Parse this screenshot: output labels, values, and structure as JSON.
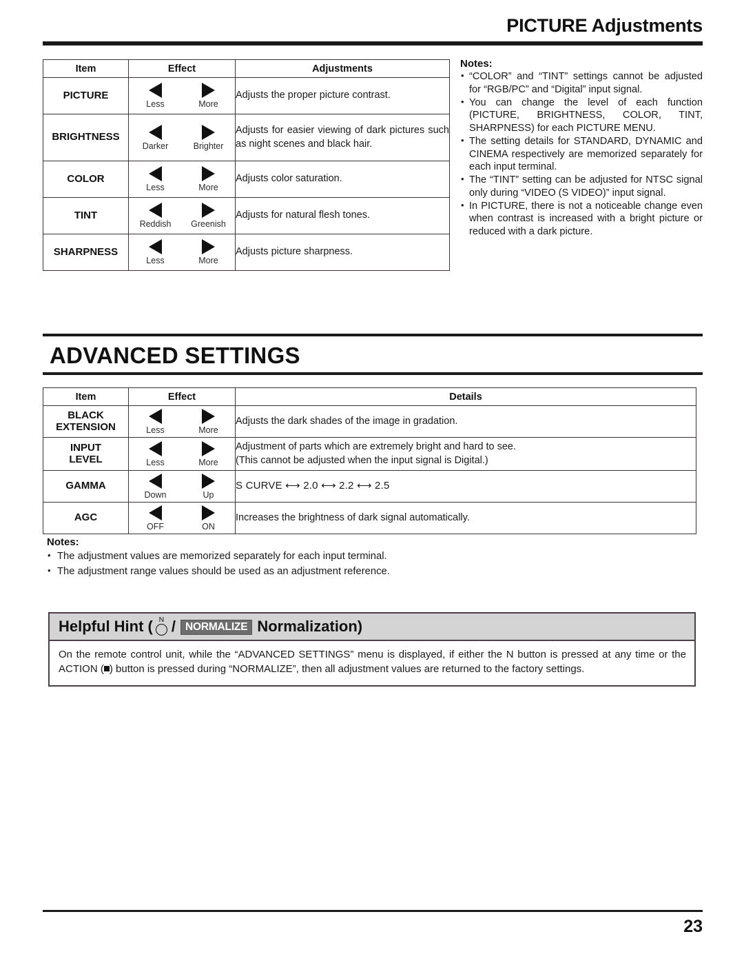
{
  "header": {
    "title": "PICTURE Adjustments"
  },
  "picture_table": {
    "columns": [
      "Item",
      "Effect",
      "Adjustments"
    ],
    "rows": [
      {
        "item": "PICTURE",
        "effect_left": "Less",
        "effect_right": "More",
        "description": "Adjusts the proper picture contrast."
      },
      {
        "item": "BRIGHTNESS",
        "effect_left": "Darker",
        "effect_right": "Brighter",
        "description": "Adjusts for easier viewing of dark pictures such as night scenes and black hair."
      },
      {
        "item": "COLOR",
        "effect_left": "Less",
        "effect_right": "More",
        "description": "Adjusts color saturation."
      },
      {
        "item": "TINT",
        "effect_left": "Reddish",
        "effect_right": "Greenish",
        "description": "Adjusts for natural flesh tones."
      },
      {
        "item": "SHARPNESS",
        "effect_left": "Less",
        "effect_right": "More",
        "description": "Adjusts picture sharpness."
      }
    ]
  },
  "picture_notes": {
    "heading": "Notes:",
    "items": [
      "“COLOR” and “TINT” settings cannot be adjusted for “RGB/PC” and “Digital” input signal.",
      "You can change the level of each function (PICTURE, BRIGHTNESS, COLOR, TINT, SHARPNESS) for each PICTURE MENU.",
      "The setting details for STANDARD, DYNAMIC and CINEMA respectively are memorized separately for each input terminal.",
      "The “TINT” setting can be adjusted for NTSC signal only during “VIDEO (S VIDEO)” input signal.",
      "In PICTURE, there is not a noticeable change even when contrast is increased with a bright picture or reduced with a dark picture."
    ]
  },
  "advanced_section": {
    "title": "ADVANCED SETTINGS"
  },
  "advanced_table": {
    "columns": [
      "Item",
      "Effect",
      "Details"
    ],
    "rows": [
      {
        "item": "BLACK\nEXTENSION",
        "effect_left": "Less",
        "effect_right": "More",
        "description": "Adjusts the dark shades of the image in gradation."
      },
      {
        "item": "INPUT\nLEVEL",
        "effect_left": "Less",
        "effect_right": "More",
        "description": "Adjustment of parts which are extremely bright and hard to see.\n(This cannot be adjusted when the input signal is Digital.)"
      },
      {
        "item": "GAMMA",
        "effect_left": "Down",
        "effect_right": "Up",
        "description": "S CURVE ⟷ 2.0 ⟷ 2.2 ⟷ 2.5"
      },
      {
        "item": "AGC",
        "effect_left": "OFF",
        "effect_right": "ON",
        "description": "Increases the brightness of dark signal automatically."
      }
    ]
  },
  "advanced_notes": {
    "heading": "Notes:",
    "items": [
      "The adjustment values are memorized separately for each input terminal.",
      "The adjustment range values should be used as an adjustment reference."
    ]
  },
  "helpful_hint": {
    "title_prefix": "Helpful Hint (",
    "n_button_label": "N",
    "slash": "/",
    "normalize_badge": "NORMALIZE",
    "title_suffix": "Normalization)",
    "body_part1": "On the remote control unit, while the “ADVANCED SETTINGS” menu is displayed, if either the N button is pressed at any time or the ACTION (",
    "body_part2": ") button is pressed during “NORMALIZE”, then all adjustment values are returned to the factory settings."
  },
  "footer": {
    "page_number": "23"
  }
}
